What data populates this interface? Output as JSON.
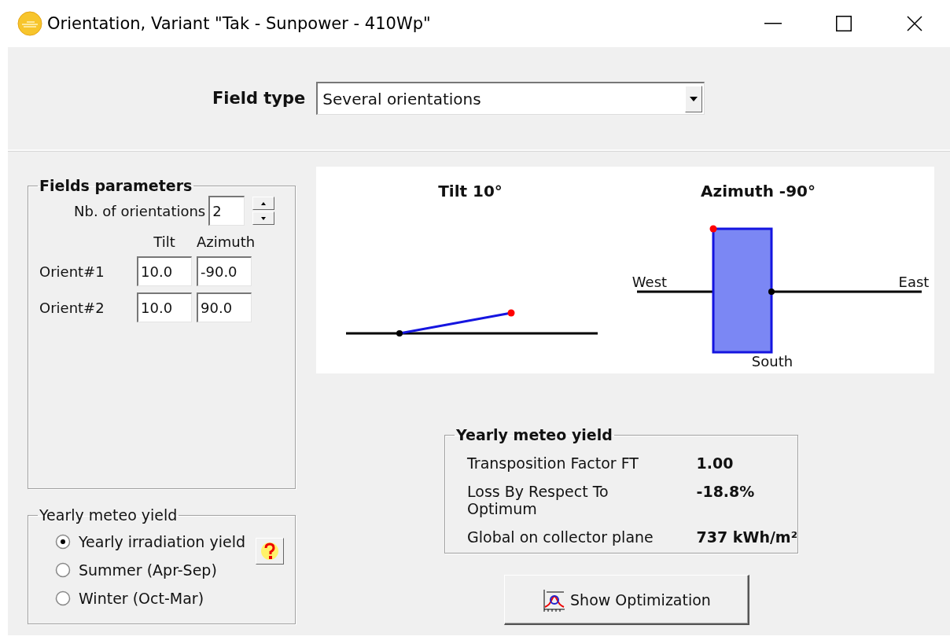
{
  "window": {
    "title": "Orientation, Variant \"Tak - Sunpower - 410Wp\""
  },
  "field_type": {
    "label": "Field type",
    "value": "Several orientations"
  },
  "fields_parameters": {
    "title": "Fields parameters",
    "count_label": "Nb. of orientations",
    "count": "2",
    "columns": [
      "Tilt",
      "Azimuth"
    ],
    "orientations": [
      {
        "label": "Orient#1",
        "tilt": "10.0",
        "azimuth": "-90.0"
      },
      {
        "label": "Orient#2",
        "tilt": "10.0",
        "azimuth": "90.0"
      }
    ]
  },
  "period": {
    "title": "Yearly meteo yield",
    "options": [
      {
        "label": "Yearly irradiation yield",
        "selected": true
      },
      {
        "label": "Summer (Apr-Sep)",
        "selected": false
      },
      {
        "label": "Winter (Oct-Mar)",
        "selected": false
      }
    ]
  },
  "diagram": {
    "tilt_title": "Tilt 10°",
    "azimuth_title": "Azimuth -90°",
    "west": "West",
    "east": "East",
    "south": "South"
  },
  "yield": {
    "title": "Yearly meteo yield",
    "rows": [
      {
        "label": "Transposition Factor FT",
        "value": "1.00"
      },
      {
        "label": "Loss By Respect To Optimum",
        "value": "-18.8%"
      },
      {
        "label": "Global on collector plane",
        "value": "737 kWh/m²"
      }
    ]
  },
  "button": "Show Optimization"
}
